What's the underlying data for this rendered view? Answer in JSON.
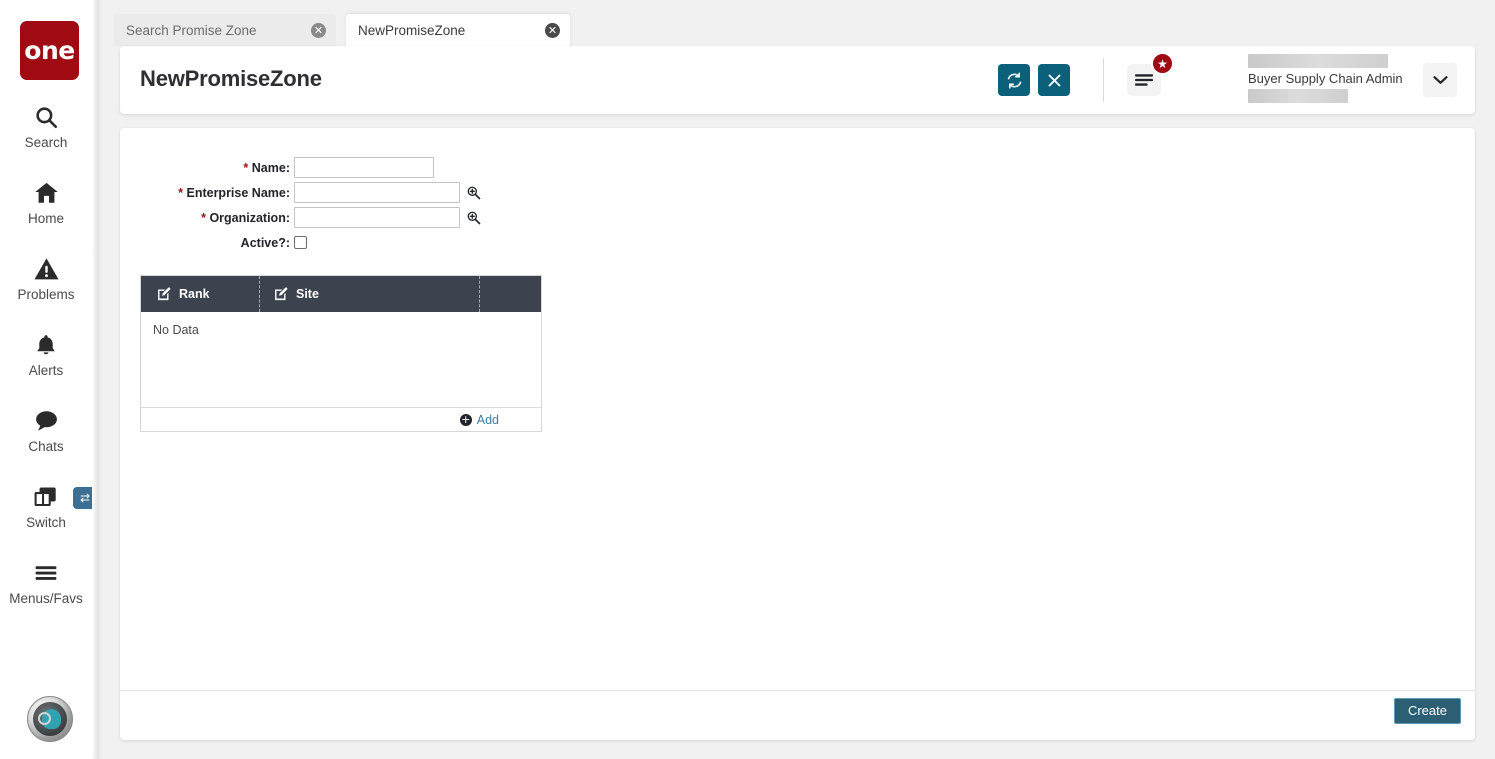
{
  "sidebar": {
    "logo_text": "one",
    "items": [
      {
        "label": "Search",
        "icon": "search-icon"
      },
      {
        "label": "Home",
        "icon": "home-icon"
      },
      {
        "label": "Problems",
        "icon": "warning-triangle-icon"
      },
      {
        "label": "Alerts",
        "icon": "bell-icon"
      },
      {
        "label": "Chats",
        "icon": "chat-bubble-icon"
      },
      {
        "label": "Switch",
        "icon": "windows-stack-icon"
      },
      {
        "label": "Menus/Favs",
        "icon": "hamburger-icon"
      }
    ],
    "switch_badge_glyph": "⇄",
    "avatar": "user-avatar"
  },
  "tabs": [
    {
      "label": "Search Promise Zone",
      "active": false
    },
    {
      "label": "NewPromiseZone",
      "active": true
    }
  ],
  "header": {
    "title": "NewPromiseZone",
    "refresh_label": "refresh",
    "close_label": "close",
    "menu_label": "menu",
    "badge_glyph": "★",
    "user_role": "Buyer Supply Chain Admin",
    "caret_glyph": "⌄"
  },
  "form": {
    "fields": [
      {
        "label": "Name:",
        "required": true,
        "value": "",
        "placeholder": "",
        "lookup": false
      },
      {
        "label": "Enterprise Name:",
        "required": true,
        "value": "",
        "placeholder": "",
        "lookup": true
      },
      {
        "label": "Organization:",
        "required": true,
        "value": "",
        "placeholder": "",
        "lookup": true
      }
    ],
    "active_label": "Active?:",
    "active_checked": false
  },
  "grid": {
    "columns": [
      {
        "label": "Rank",
        "icon": "edit-pencil-icon"
      },
      {
        "label": "Site",
        "icon": "edit-pencil-icon"
      }
    ],
    "empty_text": "No Data",
    "add_label": "Add",
    "add_icon": "plus-circle-icon"
  },
  "footer": {
    "create_label": "Create"
  },
  "colors": {
    "brand_red": "#a00a12",
    "teal_accent": "#0b607a",
    "grid_header": "#3c434f",
    "create_button": "#2d5f74",
    "required_star": "#9b1010",
    "link_blue": "#3a7ca8",
    "page_bg": "#f1f1f2"
  }
}
